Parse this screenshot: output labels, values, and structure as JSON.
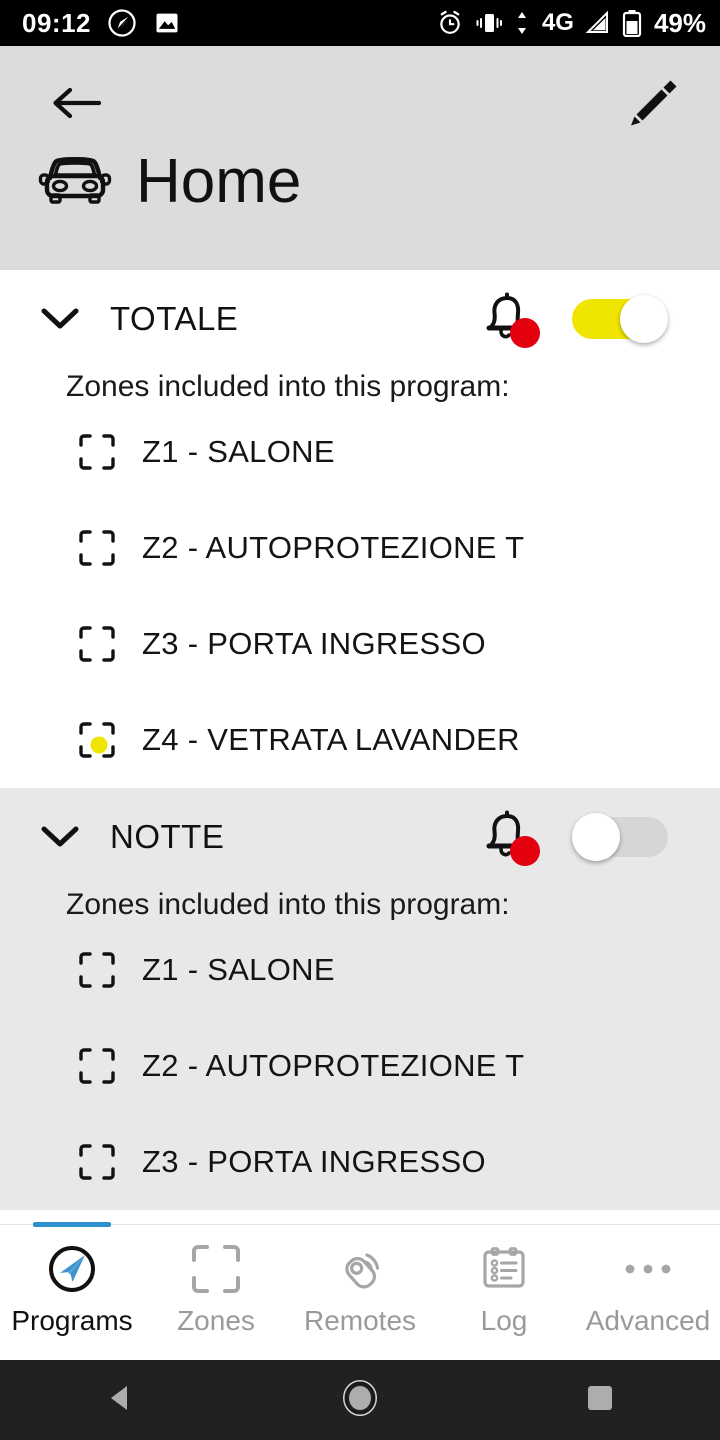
{
  "statusbar": {
    "time": "09:12",
    "battery": "49%",
    "network_label": "4G",
    "icons": [
      "navigation-icon",
      "image-icon",
      "alarm-icon",
      "vibrate-icon",
      "data-transfer-icon",
      "signal-icon",
      "battery-icon"
    ]
  },
  "header": {
    "back_icon": "back-arrow-icon",
    "edit_icon": "pencil-icon",
    "site_icon": "car-icon",
    "title": "Home",
    "background_color": "#dcdcdc"
  },
  "programs": [
    {
      "name": "TOTALE",
      "expanded": true,
      "alarm_icon": "bell-icon",
      "alarm_badge_color": "#e3000f",
      "toggle_state": "on",
      "toggle_on_color": "#f0e500",
      "zones_label": "Zones included into this program:",
      "zones": [
        {
          "label": "Z1 - SALONE",
          "active": false
        },
        {
          "label": "Z2 - AUTOPROTEZIONE T",
          "active": false
        },
        {
          "label": "Z3 - PORTA INGRESSO",
          "active": false
        },
        {
          "label": "Z4 - VETRATA LAVANDER",
          "active": true,
          "dot_color": "#f0e500"
        }
      ]
    },
    {
      "name": "NOTTE",
      "expanded": true,
      "alarm_icon": "bell-icon",
      "alarm_badge_color": "#e3000f",
      "toggle_state": "off",
      "toggle_off_color": "#d6d6d6",
      "zones_label": "Zones included into this program:",
      "zones": [
        {
          "label": "Z1 - SALONE",
          "active": false
        },
        {
          "label": "Z2 - AUTOPROTEZIONE T",
          "active": false
        },
        {
          "label": "Z3 - PORTA INGRESSO",
          "active": false
        }
      ]
    }
  ],
  "tabbar": {
    "active_color": "#2f90cf",
    "inactive_color": "#9a9a9a",
    "tabs": [
      {
        "label": "Programs",
        "icon": "paper-plane-circle-icon",
        "active": true
      },
      {
        "label": "Zones",
        "icon": "zone-bracket-icon",
        "active": false
      },
      {
        "label": "Remotes",
        "icon": "remote-key-fob-icon",
        "active": false
      },
      {
        "label": "Log",
        "icon": "clipboard-list-icon",
        "active": false
      },
      {
        "label": "Advanced",
        "icon": "ellipsis-icon",
        "active": false
      }
    ]
  },
  "navbar": {
    "back": "nav-back-icon",
    "home": "nav-home-icon",
    "recents": "nav-recents-icon"
  }
}
